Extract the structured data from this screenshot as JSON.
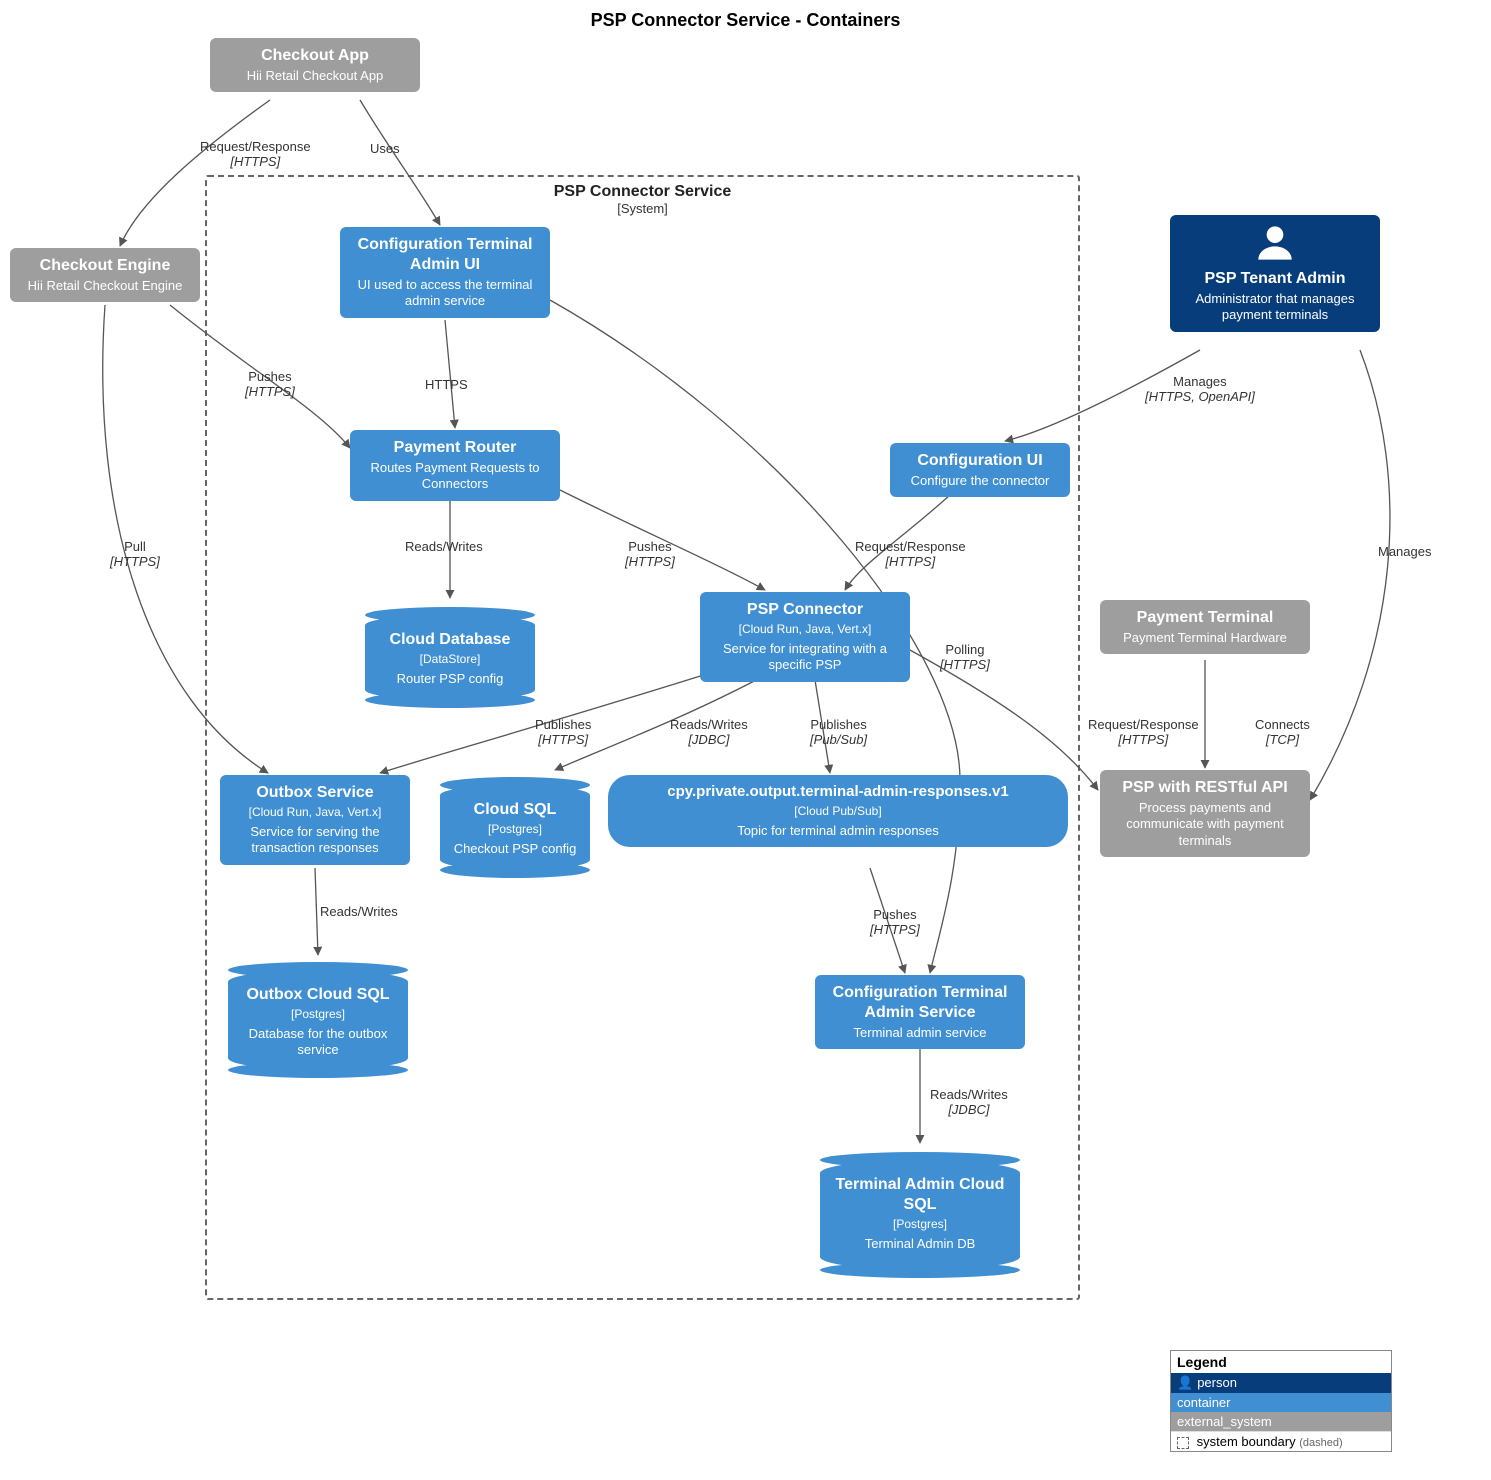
{
  "title": "PSP Connector Service - Containers",
  "boundary": {
    "title": "PSP Connector Service",
    "subtitle": "[System]"
  },
  "nodes": {
    "checkout_app": {
      "name": "Checkout App",
      "tech": "",
      "desc": "Hii Retail Checkout App"
    },
    "checkout_engine": {
      "name": "Checkout Engine",
      "tech": "",
      "desc": "Hii Retail Checkout Engine"
    },
    "psp_admin": {
      "name": "PSP Tenant Admin",
      "tech": "",
      "desc": "Administrator that manages payment terminals"
    },
    "payment_terminal": {
      "name": "Payment Terminal",
      "tech": "",
      "desc": "Payment Terminal Hardware"
    },
    "psp_api": {
      "name": "PSP with RESTful API",
      "tech": "",
      "desc": "Process payments and communicate with payment terminals"
    },
    "config_admin_ui": {
      "name": "Configuration Terminal Admin UI",
      "tech": "",
      "desc": "UI used to access the terminal admin service"
    },
    "payment_router": {
      "name": "Payment Router",
      "tech": "",
      "desc": "Routes Payment Requests to Connectors"
    },
    "config_ui": {
      "name": "Configuration UI",
      "tech": "",
      "desc": "Configure the connector"
    },
    "psp_connector": {
      "name": "PSP Connector",
      "tech": "[Cloud Run, Java, Vert.x]",
      "desc": "Service for integrating with a specific PSP"
    },
    "cloud_db": {
      "name": "Cloud Database",
      "tech": "[DataStore]",
      "desc": "Router PSP config"
    },
    "outbox_service": {
      "name": "Outbox Service",
      "tech": "[Cloud Run, Java, Vert.x]",
      "desc": "Service for serving the transaction responses"
    },
    "cloud_sql": {
      "name": "Cloud SQL",
      "tech": "[Postgres]",
      "desc": "Checkout PSP config"
    },
    "topic": {
      "name": "cpy.private.output.terminal-admin-responses.v1",
      "tech": "[Cloud Pub/Sub]",
      "desc": "Topic for terminal admin responses"
    },
    "config_admin_svc": {
      "name": "Configuration Terminal Admin Service",
      "tech": "",
      "desc": "Terminal admin service"
    },
    "outbox_sql": {
      "name": "Outbox Cloud SQL",
      "tech": "[Postgres]",
      "desc": "Database for the outbox service"
    },
    "terminal_admin_sql": {
      "name": "Terminal Admin Cloud SQL",
      "tech": "[Postgres]",
      "desc": "Terminal Admin DB"
    }
  },
  "edges": {
    "e1": {
      "label": "Request/Response",
      "tech": "[HTTPS]"
    },
    "e2": {
      "label": "Uses",
      "tech": ""
    },
    "e3": {
      "label": "Pushes",
      "tech": "[HTTPS]"
    },
    "e4": {
      "label": "HTTPS",
      "tech": ""
    },
    "e5": {
      "label": "Manages",
      "tech": "[HTTPS, OpenAPI]"
    },
    "e6": {
      "label": "Manages",
      "tech": ""
    },
    "e7": {
      "label": "Reads/Writes",
      "tech": ""
    },
    "e8": {
      "label": "Pushes",
      "tech": "[HTTPS]"
    },
    "e9": {
      "label": "Request/Response",
      "tech": "[HTTPS]"
    },
    "e10": {
      "label": "Pull",
      "tech": "[HTTPS]"
    },
    "e11": {
      "label": "Publishes",
      "tech": "[HTTPS]"
    },
    "e12": {
      "label": "Reads/Writes",
      "tech": "[JDBC]"
    },
    "e13": {
      "label": "Publishes",
      "tech": "[Pub/Sub]"
    },
    "e14": {
      "label": "Polling",
      "tech": "[HTTPS]"
    },
    "e15": {
      "label": "Request/Response",
      "tech": "[HTTPS]"
    },
    "e16": {
      "label": "Connects",
      "tech": "[TCP]"
    },
    "e17": {
      "label": "Pushes",
      "tech": "[HTTPS]"
    },
    "e18": {
      "label": "Reads/Writes",
      "tech": ""
    },
    "e19": {
      "label": "Reads/Writes",
      "tech": "[JDBC]"
    }
  },
  "legend": {
    "title": "Legend",
    "person": "person",
    "container": "container",
    "external": "external_system",
    "boundary": "system boundary",
    "dashed": "(dashed)"
  }
}
